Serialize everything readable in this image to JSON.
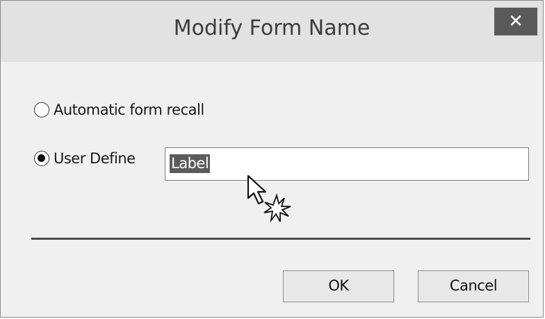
{
  "dialog": {
    "title": "Modify Form Name",
    "close_label": "✕"
  },
  "options": {
    "automatic_label": "Automatic form recall",
    "automatic_checked": false,
    "user_define_label": "User Define",
    "user_define_checked": true
  },
  "name_field": {
    "value": "Label"
  },
  "buttons": {
    "ok_label": "OK",
    "cancel_label": "Cancel"
  },
  "icons": {
    "close": "close-icon",
    "cursor": "mouse-pointer-icon",
    "click": "click-burst-icon"
  }
}
